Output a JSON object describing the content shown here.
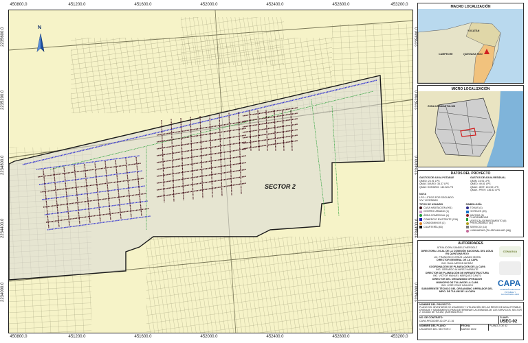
{
  "map": {
    "top_coords": [
      "450800.0",
      "451200.0",
      "451600.0",
      "452000.0",
      "452400.0",
      "452800.0",
      "453200.0"
    ],
    "bottom_coords": [
      "450800.0",
      "451200.0",
      "451600.0",
      "452000.0",
      "452400.0",
      "452800.0",
      "453200.0"
    ],
    "left_coords": [
      "2235600.0",
      "2235200.0",
      "2234800.0",
      "2234400.0",
      "2234000.0"
    ],
    "right_coords": [
      "2235600.0",
      "2235200.0",
      "2234800.0",
      "2234400.0",
      "2234000.0"
    ],
    "sector_label": "SECTOR 2",
    "north_label": "N",
    "colors": {
      "background": "#f6f3c8",
      "streets": "#8a8a6e",
      "boundary": "#1a1a1a",
      "sector_fill": "#d9d9d9",
      "network_blue": "#3a3ad0",
      "network_dark": "#4a1a22",
      "network_green": "#2aa03a"
    }
  },
  "macro": {
    "title": "MACRO LOCALIZACIÓN",
    "labels": [
      "YUCATÁN",
      "QUINTANA ROO",
      "CAMPECHE"
    ]
  },
  "micro": {
    "title": "MICRO LOCALIZACIÓN",
    "labels": [
      "ZONA URBANA TULUM"
    ]
  },
  "project": {
    "title": "DATOS DEL PROYECTO",
    "col1_title": "GASTOS DE AGUA POTABLE",
    "col1": [
      "QMED: 24.91 LPS",
      "QMAX DIARIO: 35.37 LPS",
      "QMAX HORARIO: 142.38 LPS"
    ],
    "col2_title": "GASTOS DE AGUA RESIDUAL",
    "col2": [
      "QMIN: 24.91 LPS",
      "QMED: 49.81 LPS",
      "QMAX. INST: 123.92 LPS",
      "QMAX. PREV: 136.52 LPS"
    ],
    "nota_title": "NOTA",
    "nota": [
      "LPS: LITROS POR SEGUNDO",
      "VIV: VIVIENDAS"
    ]
  },
  "legend": {
    "left_title": "TIPOS DE USUARIO",
    "left_items": [
      "CASA HABITACIÓN (991)",
      "CENTRO URBANO (1)",
      "ÁREA COMERCIAL (4)",
      "COMERCIO EXISTENTE (136)",
      "CONDOMINIOS (1)",
      "CUARTERÍA (83)"
    ],
    "right_title": "SIMBOLOGÍA",
    "right_items": [
      "TOMAS (4)",
      "HOTELES (25)",
      "MAYRAS (8)",
      "PLURIFAMILIAR VERTICAL/DEPARTAMENTO (8)",
      "PRESCINDIBLE (41)",
      "SERVICIO (14)",
      "LUMINARIAS (PLURIFAMILIAR (68))"
    ],
    "left_colors": [
      "#4a1a22",
      "#c99ac9",
      "#1e9e3a",
      "#1a1ab0",
      "#e08020",
      "#111111"
    ],
    "right_colors": [
      "#2a2a8a",
      "#1a73c9",
      "#8a2020",
      "#2aa03a",
      "#b2a020",
      "#7a7a7a",
      "#c46a9a"
    ]
  },
  "authorities": {
    "title": "AUTORIDADES",
    "names": [
      "ATRALIDORA SANDELZ MERODLZ",
      "DIRECTORA LOCAL DE LA COMISIÓN NACIONAL DEL AGUA EN QUINTANA ROO",
      "LIC. FRANCISCO JESÚS LAVADO MORA",
      "DIRECTOR GENERAL DE LA CAPA",
      "ING. RAÚL MEROD MERÁZ",
      "COORDINACIÓN DE PLANEACIÓN DE LA CAPA",
      "ING. GERARDO ALVAREZ HARAUTE",
      "DIRECTOR DE PLANEACIÓN DE INFRAESTRUCTURA",
      "ING. VÍCTOR MANUEL MÁRQUEZ CANTÚ",
      "DIRECTOR DEL ORGANISMO OPERADOR",
      "MUNICIPIO DE TULUM DE LA CAPA",
      "ING. JOSÉ CRUZ CAHUICH",
      "SUBGERENTE TÉCNICO DEL ORGANISMO OPERADOR DEL MPIO. DE TULUM DE LA CAPA"
    ],
    "conagua": "CONAGUA",
    "capa": "CAPA",
    "capa_sub": "COMISIÓN DE AGUA POTABLE Y ALCANTARILLADO"
  },
  "titleblock": {
    "nombre_proyecto": "NOMBRE DEL PROYECTO:",
    "descripcion": "PLANO DEL INVENTARIO DE USUARIOS Y UTILIZACIÓN DE LAS REDES DE AGUA POTABLE, DRENAJE Y SANEAMIENTO PARA DETERMINAR LA DEMANDA DE LOS SERVICIOS, SECTOR 2, CIUDAD DE TULUM, QUINTANA ROO.",
    "contrato_label": "NO. DE CONTRATO:",
    "contrato": "CAPA-PRODDER-ID-OP-17-16",
    "plano_label": "NOMBRE DEL PLANO:",
    "plano": "USUARIOS DEL SECTOR 2",
    "fecha_label": "FECHA:",
    "fecha": "MARZO 2022",
    "hoja": "PLANO 2 DE 42",
    "clave_label": "CLAVE:",
    "clave": "USEC-02"
  }
}
